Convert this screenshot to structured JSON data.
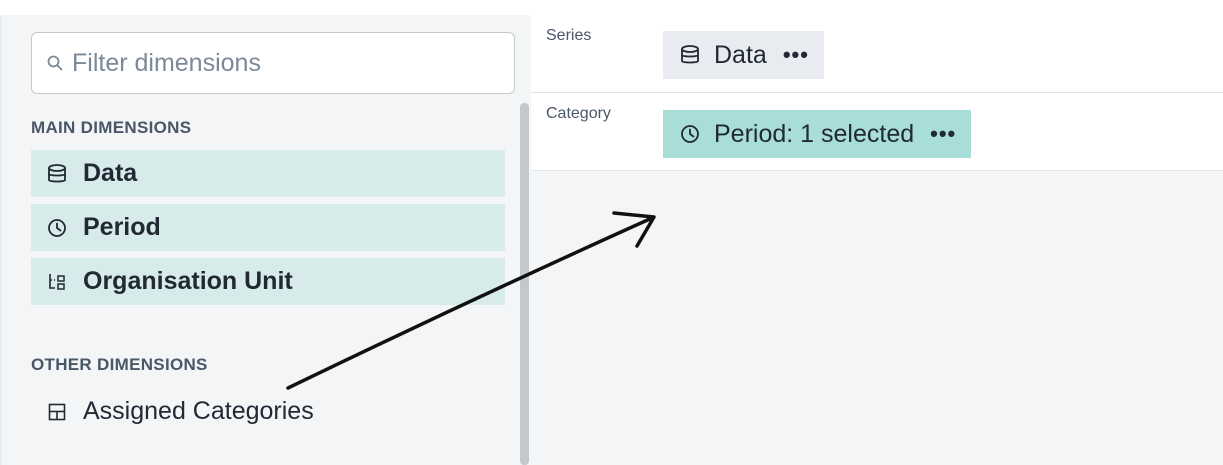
{
  "filter": {
    "placeholder": "Filter dimensions"
  },
  "main_dimensions": {
    "title": "MAIN DIMENSIONS",
    "items": [
      {
        "label": "Data",
        "icon": "database-icon"
      },
      {
        "label": "Period",
        "icon": "clock-icon"
      },
      {
        "label": "Organisation Unit",
        "icon": "org-unit-tree-icon"
      }
    ]
  },
  "other_dimensions": {
    "title": "OTHER DIMENSIONS",
    "items": [
      {
        "label": "Assigned Categories",
        "icon": "table-grid-icon"
      }
    ]
  },
  "layout": {
    "series": {
      "label": "Series",
      "chip_label": "Data",
      "chip_icon": "database-icon",
      "more": "•••"
    },
    "category": {
      "label": "Category",
      "chip_label": "Period: 1 selected",
      "chip_icon": "clock-icon",
      "more": "•••"
    }
  },
  "colors": {
    "main_item_bg": "#d7ecea",
    "category_chip_bg": "#a9ddd7",
    "series_chip_bg": "#e8ecf1",
    "panel_bg": "#f3f5f7"
  },
  "annotation": {
    "type": "hand-drawn-arrow",
    "from": "Assigned Categories",
    "to": "Category row"
  }
}
